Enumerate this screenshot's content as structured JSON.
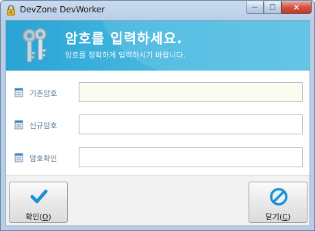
{
  "window": {
    "title": "DevZone DevWorker",
    "minimize_label": "—",
    "maximize_label": "□",
    "close_label": "✕"
  },
  "banner": {
    "title": "암호를 입력하세요.",
    "subtitle": "암호를 정확하게 입력하시기 바랍니다."
  },
  "fields": [
    {
      "label": "기존암호",
      "value": "",
      "icon": "notepad-icon"
    },
    {
      "label": "신규암호",
      "value": "",
      "icon": "notepad-icon"
    },
    {
      "label": "암호확인",
      "value": "",
      "icon": "notepad-icon"
    }
  ],
  "buttons": {
    "ok": {
      "label": "확인(",
      "mnemonic": "O",
      "suffix": ")",
      "icon": "checkmark-icon"
    },
    "close": {
      "label": "닫기(",
      "mnemonic": "C",
      "suffix": ")",
      "icon": "prohibited-icon"
    }
  },
  "colors": {
    "banner": "#3fb2dc",
    "checkmark": "#1d8fd6",
    "close_icon": "#1e8fd3"
  }
}
